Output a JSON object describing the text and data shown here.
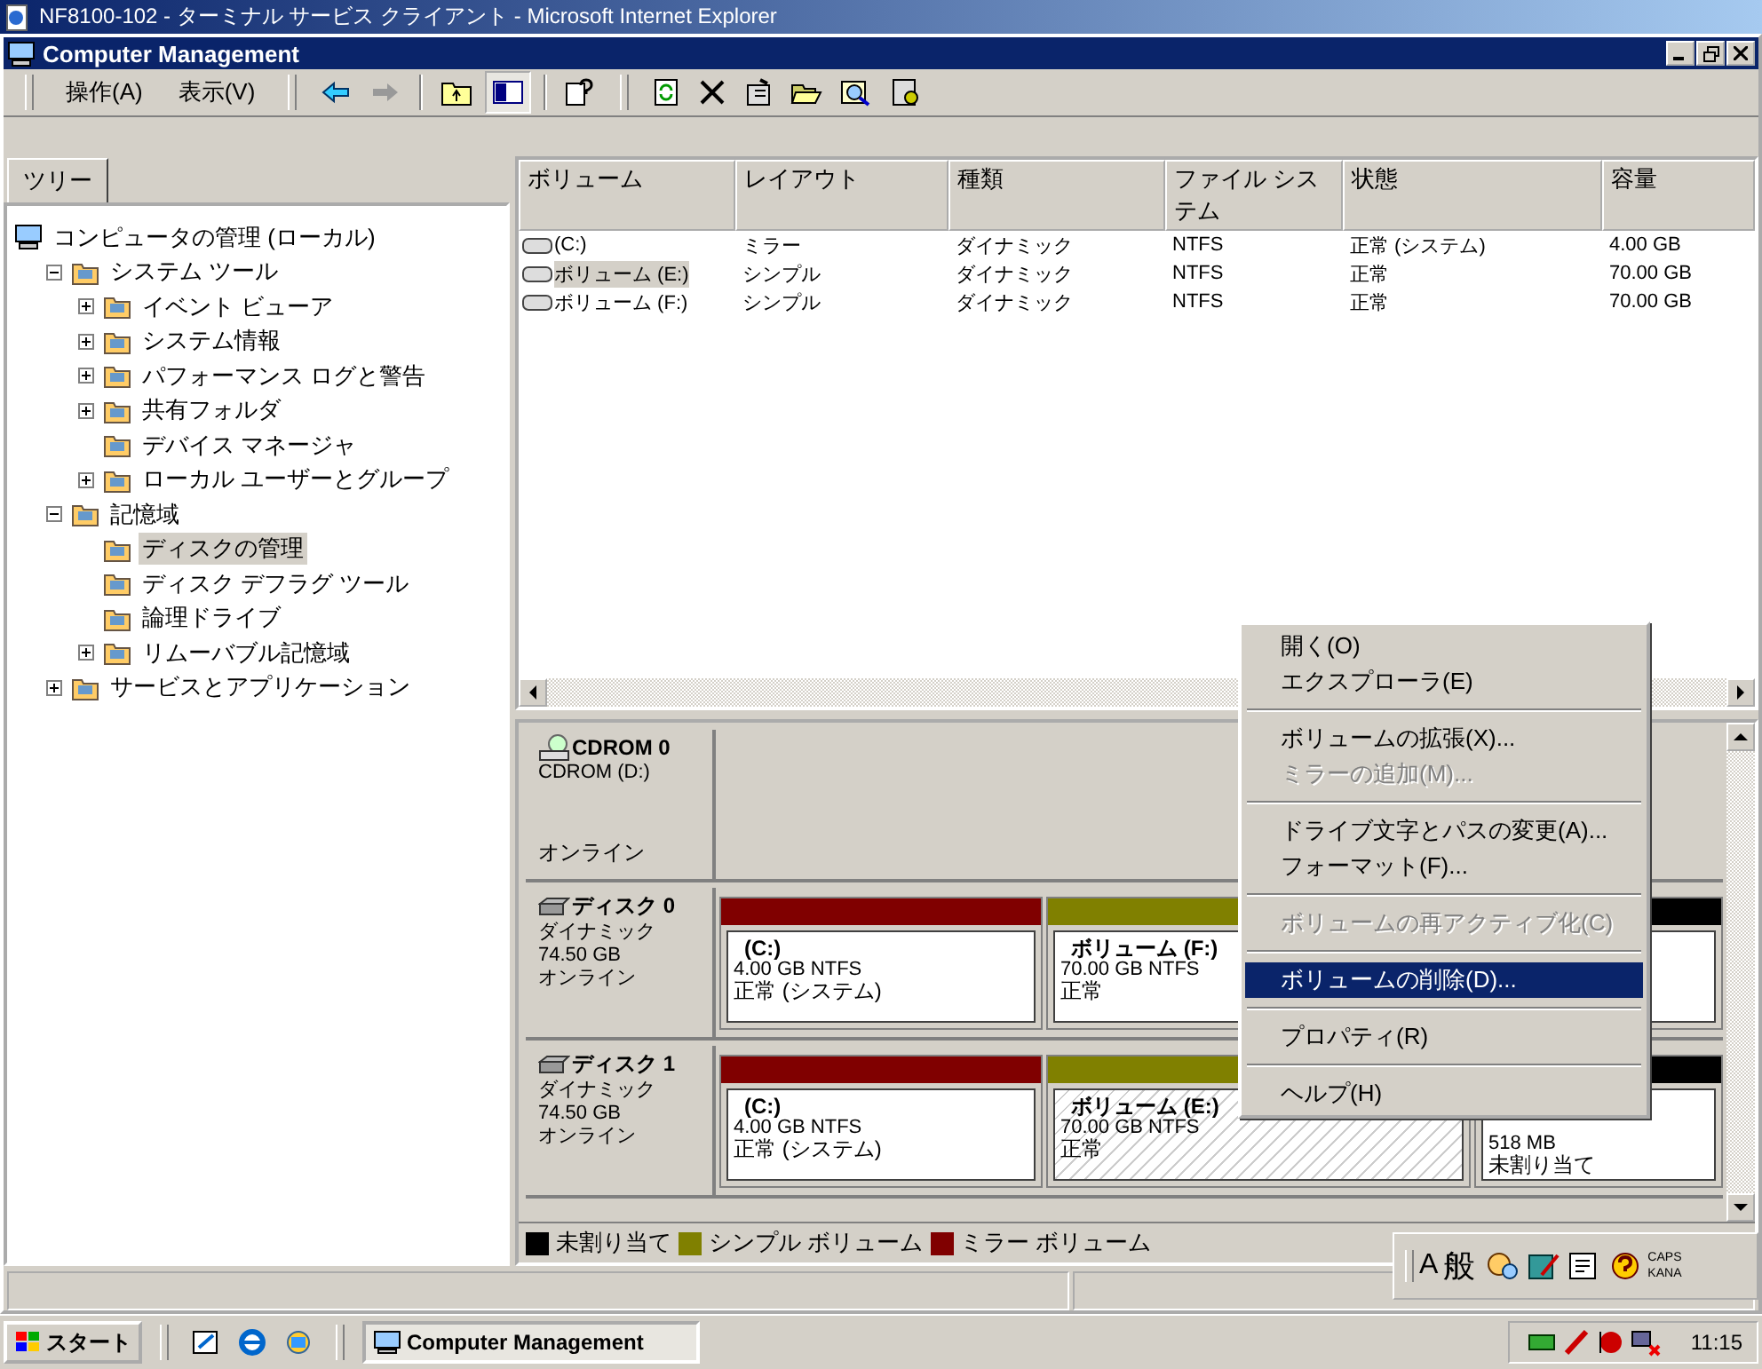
{
  "browser_window": {
    "title": "NF8100-102 - ターミナル サービス クライアント - Microsoft Internet Explorer"
  },
  "app_window": {
    "title": "Computer Management"
  },
  "menus": [
    "操作(A)",
    "表示(V)"
  ],
  "tree": {
    "tab": "ツリー",
    "nodes": [
      {
        "label": "コンピュータの管理 (ローカル)",
        "kind": "root",
        "selected": false,
        "children": [
          {
            "label": "システム ツール",
            "kind": "branch",
            "expanded": true,
            "selected": false,
            "children": [
              {
                "label": "イベント ビューア",
                "kind": "branch",
                "expanded": false,
                "selected": false
              },
              {
                "label": "システム情報",
                "kind": "branch",
                "expanded": false,
                "selected": false
              },
              {
                "label": "パフォーマンス ログと警告",
                "kind": "branch",
                "expanded": false,
                "selected": false
              },
              {
                "label": "共有フォルダ",
                "kind": "branch",
                "expanded": false,
                "selected": false
              },
              {
                "label": "デバイス マネージャ",
                "kind": "leaf",
                "selected": false
              },
              {
                "label": "ローカル ユーザーとグループ",
                "kind": "branch",
                "expanded": false,
                "selected": false
              }
            ]
          },
          {
            "label": "記憶域",
            "kind": "branch",
            "expanded": true,
            "selected": false,
            "children": [
              {
                "label": "ディスクの管理",
                "kind": "leaf",
                "selected": true
              },
              {
                "label": "ディスク デフラグ ツール",
                "kind": "leaf",
                "selected": false
              },
              {
                "label": "論理ドライブ",
                "kind": "leaf",
                "selected": false
              },
              {
                "label": "リムーバブル記憶域",
                "kind": "branch",
                "expanded": false,
                "selected": false
              }
            ]
          },
          {
            "label": "サービスとアプリケーション",
            "kind": "branch",
            "expanded": false,
            "selected": false
          }
        ]
      }
    ]
  },
  "volumes": {
    "columns": [
      "ボリューム",
      "レイアウト",
      "種類",
      "ファイル システム",
      "状態",
      "容量"
    ],
    "rows": [
      {
        "cells": [
          "(C:)",
          "ミラー",
          "ダイナミック",
          "NTFS",
          "正常 (システム)",
          "4.00 GB"
        ],
        "selected": false
      },
      {
        "cells": [
          "ボリューム (E:)",
          "シンプル",
          "ダイナミック",
          "NTFS",
          "正常",
          "70.00 GB"
        ],
        "selected": true
      },
      {
        "cells": [
          "ボリューム (F:)",
          "シンプル",
          "ダイナミック",
          "NTFS",
          "正常",
          "70.00 GB"
        ],
        "selected": false
      }
    ]
  },
  "disks": [
    {
      "kind": "cdrom",
      "name": "CDROM 0",
      "type": "CDROM (D:)",
      "status": "オンライン"
    },
    {
      "kind": "disk",
      "name": "ディスク 0",
      "type": "ダイナミック",
      "size": "74.50 GB",
      "status": "オンライン",
      "partitions": [
        {
          "kind": "mirror",
          "label": "(C:)",
          "size": "4.00 GB NTFS",
          "status": "正常 (システム)",
          "selected": false
        },
        {
          "kind": "simple",
          "label": "ボリューム (F:)",
          "size": "70.00 GB NTFS",
          "status": "正常",
          "selected": false
        },
        {
          "kind": "unallocated",
          "selected": false
        }
      ]
    },
    {
      "kind": "disk",
      "name": "ディスク 1",
      "type": "ダイナミック",
      "size": "74.50 GB",
      "status": "オンライン",
      "partitions": [
        {
          "kind": "mirror",
          "label": "(C:)",
          "size": "4.00 GB NTFS",
          "status": "正常 (システム)",
          "selected": false
        },
        {
          "kind": "simple",
          "label": "ボリューム (E:)",
          "size": "70.00 GB NTFS",
          "status": "正常",
          "selected": true
        },
        {
          "kind": "unallocated",
          "size": "518 MB",
          "status": "未割り当て",
          "selected": false
        }
      ]
    }
  ],
  "legend": [
    {
      "label": "未割り当て",
      "color": "#000000"
    },
    {
      "label": "シンプル ボリューム",
      "color": "#808000"
    },
    {
      "label": "ミラー ボリューム",
      "color": "#800000"
    }
  ],
  "context_menu": [
    [
      {
        "label": "開く(O)",
        "disabled": false,
        "selected": false
      },
      {
        "label": "エクスプローラ(E)",
        "disabled": false,
        "selected": false
      }
    ],
    [
      {
        "label": "ボリュームの拡張(X)...",
        "disabled": false,
        "selected": false
      },
      {
        "label": "ミラーの追加(M)...",
        "disabled": true,
        "selected": false
      }
    ],
    [
      {
        "label": "ドライブ文字とパスの変更(A)...",
        "disabled": false,
        "selected": false
      },
      {
        "label": "フォーマット(F)...",
        "disabled": false,
        "selected": false
      }
    ],
    [
      {
        "label": "ボリュームの再アクティブ化(C)",
        "disabled": true,
        "selected": false
      }
    ],
    [
      {
        "label": "ボリュームの削除(D)...",
        "disabled": false,
        "selected": true
      }
    ],
    [
      {
        "label": "プロパティ(R)",
        "disabled": false,
        "selected": false
      }
    ],
    [
      {
        "label": "ヘルプ(H)",
        "disabled": false,
        "selected": false
      }
    ]
  ],
  "ime_bar": {
    "mode": "A",
    "conversion": "般",
    "caps": "CAPS",
    "kana": "KANA"
  },
  "taskbar": {
    "start": "スタート",
    "tasks": [
      "Computer Management"
    ],
    "clock": "11:15"
  }
}
